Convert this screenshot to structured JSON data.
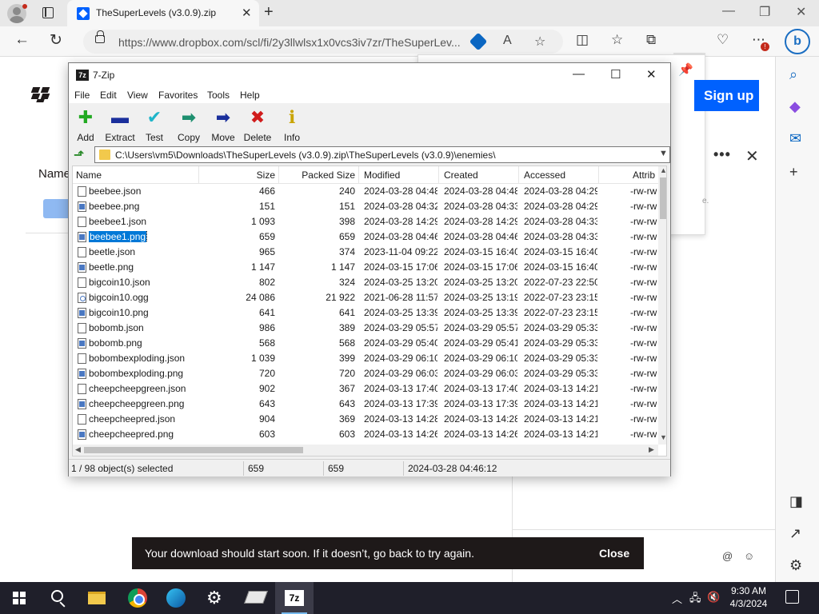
{
  "browser": {
    "tab_title": "TheSuperLevels (v3.0.9).zip",
    "url": "https://www.dropbox.com/scl/fi/2y3llwlsx1x0vcs3iv7zr/TheSuperLev...",
    "new_tab": "+",
    "close": "✕"
  },
  "dropbox": {
    "name_header": "Name",
    "signup_label": "Sign up",
    "panel_dot": "e.",
    "toast_text": "Your download should start soon. If it doesn’t, go back to try again.",
    "toast_close": "Close"
  },
  "zip": {
    "title": "7-Zip",
    "icon_text": "7z",
    "menu": [
      "File",
      "Edit",
      "View",
      "Favorites",
      "Tools",
      "Help"
    ],
    "toolbar": [
      {
        "label": "Add",
        "icon": "add-icon",
        "color": "#22aa22"
      },
      {
        "label": "Extract",
        "icon": "extract-icon",
        "color": "#1a2f9c"
      },
      {
        "label": "Test",
        "icon": "test-icon",
        "color": "#1fb5c9"
      },
      {
        "label": "Copy",
        "icon": "copy-icon",
        "color": "#1e8f6f"
      },
      {
        "label": "Move",
        "icon": "move-icon",
        "color": "#1a2f9c"
      },
      {
        "label": "Delete",
        "icon": "delete-icon",
        "color": "#d01c1c"
      },
      {
        "label": "Info",
        "icon": "info-icon",
        "color": "#c9a400"
      }
    ],
    "path": "C:\\Users\\vm5\\Downloads\\TheSuperLevels (v3.0.9).zip\\TheSuperLevels (v3.0.9)\\enemies\\",
    "columns": [
      "Name",
      "Size",
      "Packed Size",
      "Modified",
      "Created",
      "Accessed",
      "Attrib"
    ],
    "rows": [
      {
        "name": "beebee.json",
        "type": "json",
        "size": "466",
        "packed": "240",
        "modified": "2024-03-28 04:48",
        "created": "2024-03-28 04:48",
        "accessed": "2024-03-28 04:29",
        "attrib": "-rw-rw"
      },
      {
        "name": "beebee.png",
        "type": "png",
        "size": "151",
        "packed": "151",
        "modified": "2024-03-28 04:32",
        "created": "2024-03-28 04:33",
        "accessed": "2024-03-28 04:29",
        "attrib": "-rw-rw"
      },
      {
        "name": "beebee1.json",
        "type": "json",
        "size": "1 093",
        "packed": "398",
        "modified": "2024-03-28 14:29",
        "created": "2024-03-28 14:29",
        "accessed": "2024-03-28 04:33",
        "attrib": "-rw-rw"
      },
      {
        "name": "beebee1.png",
        "type": "png",
        "size": "659",
        "packed": "659",
        "modified": "2024-03-28 04:46",
        "created": "2024-03-28 04:46",
        "accessed": "2024-03-28 04:33",
        "attrib": "-rw-rw",
        "selected": true
      },
      {
        "name": "beetle.json",
        "type": "json",
        "size": "965",
        "packed": "374",
        "modified": "2023-11-04 09:22",
        "created": "2024-03-15 16:40",
        "accessed": "2024-03-15 16:40",
        "attrib": "-rw-rw"
      },
      {
        "name": "beetle.png",
        "type": "png",
        "size": "1 147",
        "packed": "1 147",
        "modified": "2024-03-15 17:06",
        "created": "2024-03-15 17:06",
        "accessed": "2024-03-15 16:40",
        "attrib": "-rw-rw"
      },
      {
        "name": "bigcoin10.json",
        "type": "json",
        "size": "802",
        "packed": "324",
        "modified": "2024-03-25 13:20",
        "created": "2024-03-25 13:20",
        "accessed": "2022-07-23 22:50",
        "attrib": "-rw-rw"
      },
      {
        "name": "bigcoin10.ogg",
        "type": "ogg",
        "size": "24 086",
        "packed": "21 922",
        "modified": "2021-06-28 11:57",
        "created": "2024-03-25 13:19",
        "accessed": "2022-07-23 23:15",
        "attrib": "-rw-rw"
      },
      {
        "name": "bigcoin10.png",
        "type": "png",
        "size": "641",
        "packed": "641",
        "modified": "2024-03-25 13:39",
        "created": "2024-03-25 13:39",
        "accessed": "2022-07-23 23:15",
        "attrib": "-rw-rw"
      },
      {
        "name": "bobomb.json",
        "type": "json",
        "size": "986",
        "packed": "389",
        "modified": "2024-03-29 05:57",
        "created": "2024-03-29 05:57",
        "accessed": "2024-03-29 05:33",
        "attrib": "-rw-rw"
      },
      {
        "name": "bobomb.png",
        "type": "png",
        "size": "568",
        "packed": "568",
        "modified": "2024-03-29 05:40",
        "created": "2024-03-29 05:41",
        "accessed": "2024-03-29 05:33",
        "attrib": "-rw-rw"
      },
      {
        "name": "bobombexploding.json",
        "type": "json",
        "size": "1 039",
        "packed": "399",
        "modified": "2024-03-29 06:10",
        "created": "2024-03-29 06:10",
        "accessed": "2024-03-29 05:33",
        "attrib": "-rw-rw"
      },
      {
        "name": "bobombexploding.png",
        "type": "png",
        "size": "720",
        "packed": "720",
        "modified": "2024-03-29 06:03",
        "created": "2024-03-29 06:03",
        "accessed": "2024-03-29 05:33",
        "attrib": "-rw-rw"
      },
      {
        "name": "cheepcheepgreen.json",
        "type": "json",
        "size": "902",
        "packed": "367",
        "modified": "2024-03-13 17:40",
        "created": "2024-03-13 17:40",
        "accessed": "2024-03-13 14:21",
        "attrib": "-rw-rw"
      },
      {
        "name": "cheepcheepgreen.png",
        "type": "png",
        "size": "643",
        "packed": "643",
        "modified": "2024-03-13 17:39",
        "created": "2024-03-13 17:39",
        "accessed": "2024-03-13 14:21",
        "attrib": "-rw-rw"
      },
      {
        "name": "cheepcheepred.json",
        "type": "json",
        "size": "904",
        "packed": "369",
        "modified": "2024-03-13 14:28",
        "created": "2024-03-13 14:28",
        "accessed": "2024-03-13 14:21",
        "attrib": "-rw-rw"
      },
      {
        "name": "cheepcheepred.png",
        "type": "png",
        "size": "603",
        "packed": "603",
        "modified": "2024-03-13 14:26",
        "created": "2024-03-13 14:26",
        "accessed": "2024-03-13 14:21",
        "attrib": "-rw-rw"
      }
    ],
    "status": {
      "selection": "1 / 98 object(s) selected",
      "size": "659",
      "packed": "659",
      "modified": "2024-03-28 04:46:12"
    }
  },
  "taskbar": {
    "time": "9:30 AM",
    "date": "4/3/2024",
    "sevenzip_label": "7z"
  }
}
